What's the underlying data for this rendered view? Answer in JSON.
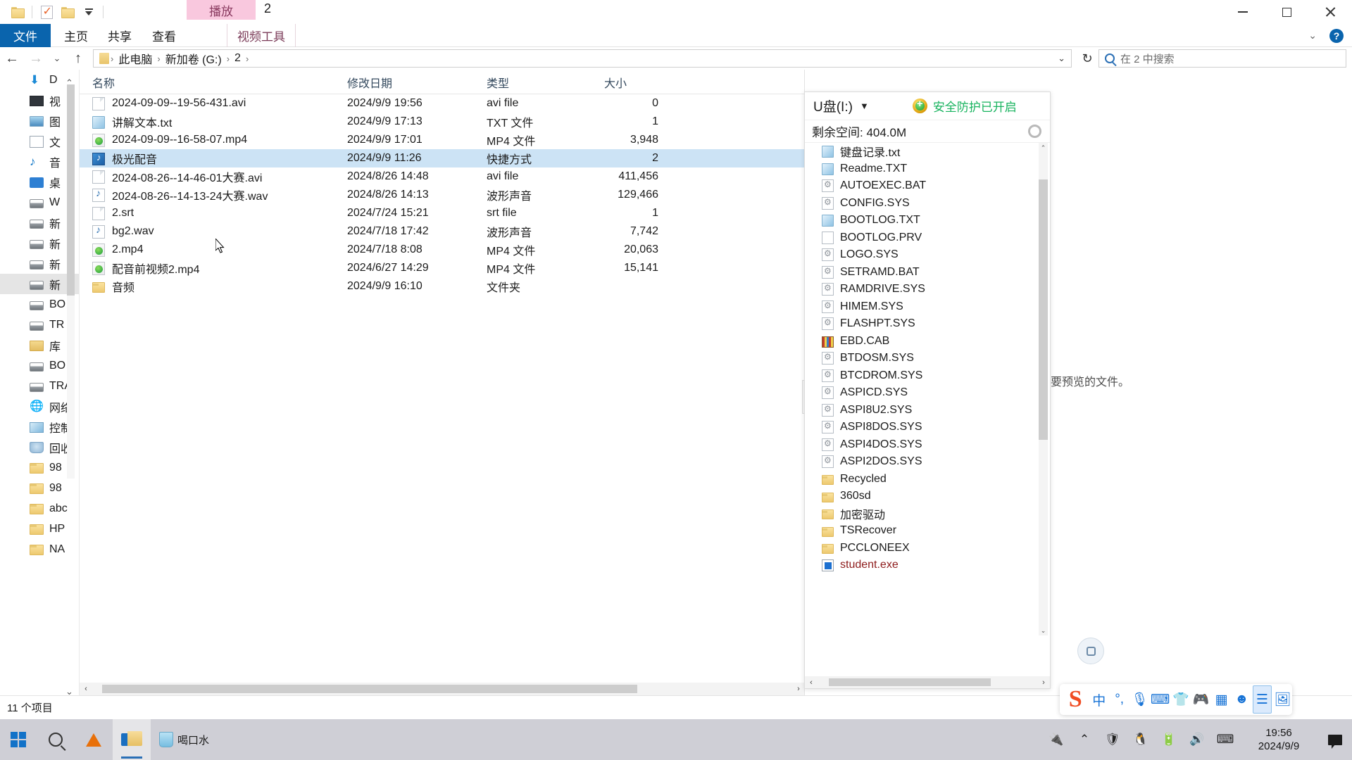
{
  "window": {
    "title": "2",
    "context_tab": "播放",
    "minimize": "—",
    "maximize": "▢",
    "close": "✕"
  },
  "ribbon": {
    "file_tab": "文件",
    "tabs": [
      "主页",
      "共享",
      "查看"
    ],
    "contextual_tab": "视频工具",
    "collapse_icon": "chevron-down",
    "help_icon": "?"
  },
  "address": {
    "back": "←",
    "forward": "→",
    "recent": "⌄",
    "up": "↑",
    "breadcrumbs": [
      "此电脑",
      "新加卷 (G:)",
      "2"
    ],
    "separator": "›",
    "dropdown": "⌄",
    "refresh": "↻",
    "search_placeholder": "在 2 中搜索"
  },
  "sidebar": {
    "items": [
      {
        "label": "D",
        "icon": "downloads-icon"
      },
      {
        "label": "视",
        "icon": "videos-icon"
      },
      {
        "label": "图",
        "icon": "pictures-icon"
      },
      {
        "label": "文",
        "icon": "documents-icon"
      },
      {
        "label": "音",
        "icon": "music-icon"
      },
      {
        "label": "桌",
        "icon": "desktop-icon"
      },
      {
        "label": "W",
        "icon": "windows-drive-icon"
      },
      {
        "label": "新",
        "icon": "drive-icon"
      },
      {
        "label": "新",
        "icon": "drive-icon"
      },
      {
        "label": "新",
        "icon": "drive-icon"
      },
      {
        "label": "新",
        "icon": "drive-icon",
        "selected": true
      },
      {
        "label": "BO",
        "icon": "drive-icon"
      },
      {
        "label": "TR",
        "icon": "drive-icon"
      },
      {
        "label": "库",
        "icon": "library-icon"
      },
      {
        "label": "BO",
        "icon": "drive-icon"
      },
      {
        "label": "TRA",
        "icon": "drive-icon"
      },
      {
        "label": "网络",
        "icon": "network-icon"
      },
      {
        "label": "控制",
        "icon": "control-panel-icon"
      },
      {
        "label": "回收",
        "icon": "recycle-bin-icon"
      },
      {
        "label": "98",
        "icon": "folder-icon"
      },
      {
        "label": "98",
        "icon": "folder-icon"
      },
      {
        "label": "abc",
        "icon": "folder-icon"
      },
      {
        "label": "HP",
        "icon": "folder-icon"
      },
      {
        "label": "NA",
        "icon": "folder-icon"
      }
    ]
  },
  "filelist": {
    "columns": [
      "名称",
      "修改日期",
      "类型",
      "大小"
    ],
    "sort_indicator": "chevron-up",
    "rows": [
      {
        "name": "2024-09-09--19-56-431.avi",
        "date": "2024/9/9 19:56",
        "type": "avi file",
        "size": "0 ",
        "icon": "blank-file-icon",
        "selected": false
      },
      {
        "name": "讲解文本.txt",
        "date": "2024/9/9 17:13",
        "type": "TXT 文件",
        "size": "1 ",
        "icon": "txt-file-icon",
        "selected": false
      },
      {
        "name": "2024-09-09--16-58-07.mp4",
        "date": "2024/9/9 17:01",
        "type": "MP4 文件",
        "size": "3,948 ",
        "icon": "mp4-file-icon",
        "selected": false
      },
      {
        "name": "极光配音",
        "date": "2024/9/9 11:26",
        "type": "快捷方式",
        "size": "2 ",
        "icon": "shortcut-icon",
        "selected": true
      },
      {
        "name": "2024-08-26--14-46-01大赛.avi",
        "date": "2024/8/26 14:48",
        "type": "avi file",
        "size": "411,456 ",
        "icon": "blank-file-icon",
        "selected": false
      },
      {
        "name": "2024-08-26--14-13-24大赛.wav",
        "date": "2024/8/26 14:13",
        "type": "波形声音",
        "size": "129,466 ",
        "icon": "wav-file-icon",
        "selected": false
      },
      {
        "name": "2.srt",
        "date": "2024/7/24 15:21",
        "type": "srt file",
        "size": "1 ",
        "icon": "blank-file-icon",
        "selected": false
      },
      {
        "name": "bg2.wav",
        "date": "2024/7/18 17:42",
        "type": "波形声音",
        "size": "7,742 ",
        "icon": "wav-file-icon",
        "selected": false
      },
      {
        "name": "2.mp4",
        "date": "2024/7/18 8:08",
        "type": "MP4 文件",
        "size": "20,063 ",
        "icon": "mp4-file-icon",
        "selected": false
      },
      {
        "name": "配音前视频2.mp4",
        "date": "2024/6/27 14:29",
        "type": "MP4 文件",
        "size": "15,141 ",
        "icon": "mp4-file-icon",
        "selected": false
      },
      {
        "name": "音频",
        "date": "2024/9/9 16:10",
        "type": "文件夹",
        "size": "",
        "icon": "folder-icon",
        "selected": false
      }
    ]
  },
  "preview": {
    "message": "选择要预览的文件。",
    "expand_icon": "›"
  },
  "usb_panel": {
    "drive_label": "U盘(I:)",
    "drive_caret": "▼",
    "protection_text": "安全防护已开启",
    "protection_color": "#17b35e",
    "free_space": "剩余空间: 404.0M",
    "settings_icon": "gear-icon",
    "files": [
      {
        "name": "键盘记录.txt",
        "icon": "txt-file-icon"
      },
      {
        "name": "Readme.TXT",
        "icon": "txt-file-icon"
      },
      {
        "name": "AUTOEXEC.BAT",
        "icon": "system-file-icon"
      },
      {
        "name": "CONFIG.SYS",
        "icon": "system-file-icon"
      },
      {
        "name": "BOOTLOG.TXT",
        "icon": "txt-file-icon"
      },
      {
        "name": "BOOTLOG.PRV",
        "icon": "blank-file-icon"
      },
      {
        "name": "LOGO.SYS",
        "icon": "system-file-icon"
      },
      {
        "name": "SETRAMD.BAT",
        "icon": "system-file-icon"
      },
      {
        "name": "RAMDRIVE.SYS",
        "icon": "system-file-icon"
      },
      {
        "name": "HIMEM.SYS",
        "icon": "system-file-icon"
      },
      {
        "name": "FLASHPT.SYS",
        "icon": "system-file-icon"
      },
      {
        "name": "EBD.CAB",
        "icon": "cab-archive-icon"
      },
      {
        "name": "BTDOSM.SYS",
        "icon": "system-file-icon"
      },
      {
        "name": "BTCDROM.SYS",
        "icon": "system-file-icon"
      },
      {
        "name": "ASPICD.SYS",
        "icon": "system-file-icon"
      },
      {
        "name": "ASPI8U2.SYS",
        "icon": "system-file-icon"
      },
      {
        "name": "ASPI8DOS.SYS",
        "icon": "system-file-icon"
      },
      {
        "name": "ASPI4DOS.SYS",
        "icon": "system-file-icon"
      },
      {
        "name": "ASPI2DOS.SYS",
        "icon": "system-file-icon"
      },
      {
        "name": "Recycled",
        "icon": "folder-icon"
      },
      {
        "name": "360sd",
        "icon": "folder-icon"
      },
      {
        "name": "加密驱动",
        "icon": "folder-icon"
      },
      {
        "name": "TSRecover",
        "icon": "folder-icon"
      },
      {
        "name": "PCCLONEEX",
        "icon": "folder-icon"
      },
      {
        "name": "student.exe",
        "icon": "exe-file-icon",
        "exe": true
      }
    ]
  },
  "statusbar": {
    "item_count": "11 个项目"
  },
  "ime": {
    "logo": "S",
    "items": [
      "中",
      "°,",
      "mic-icon",
      "keyboard-icon",
      "shirt-icon",
      "gamepad-icon",
      "apps-icon",
      "emoji-icon",
      "list-icon",
      "image-icon"
    ]
  },
  "taskbar": {
    "start_icon": "windows-logo-icon",
    "search_icon": "search-icon",
    "apps": [
      "vlc-icon",
      "file-explorer-icon"
    ],
    "water_reminder": "喝口水",
    "tray_icons": [
      "usb-icon",
      "chevron-up-icon",
      "shield-icon",
      "qq-icon",
      "battery-icon",
      "volume-icon",
      "keyboard-icon"
    ],
    "time": "19:56",
    "date": "2024/9/9",
    "notification_icon": "notification-icon"
  }
}
